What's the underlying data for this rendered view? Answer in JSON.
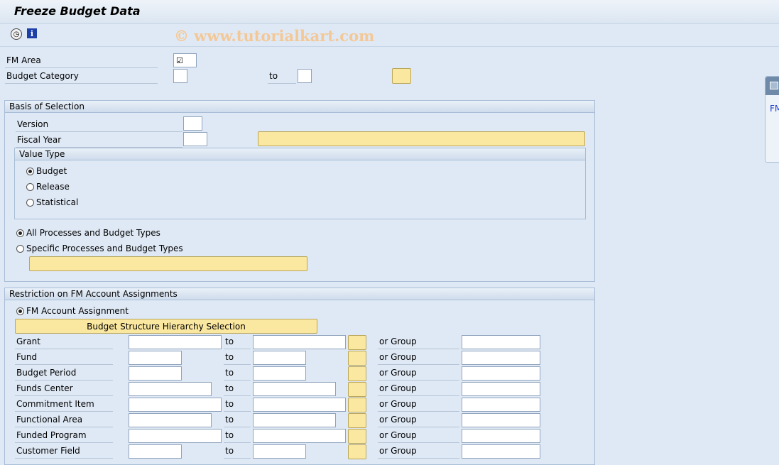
{
  "window": {
    "title": "Freeze Budget Data"
  },
  "toolbar": {
    "execute_icon": "execute-icon",
    "info_icon": "info-icon",
    "watermark": "© www.tutorialkart.com"
  },
  "header_fields": {
    "fm_area": {
      "label": "FM Area",
      "checked": true
    },
    "budget_category": {
      "label": "Budget Category",
      "to_label": "to"
    }
  },
  "basis": {
    "title": "Basis of Selection",
    "version_label": "Version",
    "fiscal_year_label": "Fiscal Year",
    "value_type": {
      "title": "Value Type",
      "options": [
        {
          "label": "Budget",
          "selected": true
        },
        {
          "label": "Release",
          "selected": false
        },
        {
          "label": "Statistical",
          "selected": false
        }
      ]
    },
    "process_options": [
      {
        "label": "All Processes and Budget Types",
        "selected": true
      },
      {
        "label": "Specific Processes and Budget Types",
        "selected": false
      }
    ]
  },
  "restriction": {
    "title": "Restriction on FM Account Assignments",
    "fm_account_assignment": "FM Account Assignment",
    "hierarchy_button": "Budget Structure Hierarchy Selection",
    "to_label": "to",
    "group_label": "or Group",
    "rows": [
      {
        "label": "Grant"
      },
      {
        "label": "Fund"
      },
      {
        "label": "Budget Period"
      },
      {
        "label": "Funds Center"
      },
      {
        "label": "Commitment Item"
      },
      {
        "label": "Functional Area"
      },
      {
        "label": "Funded Program"
      },
      {
        "label": "Customer Field"
      }
    ]
  },
  "side_panel": {
    "text": "FM"
  }
}
